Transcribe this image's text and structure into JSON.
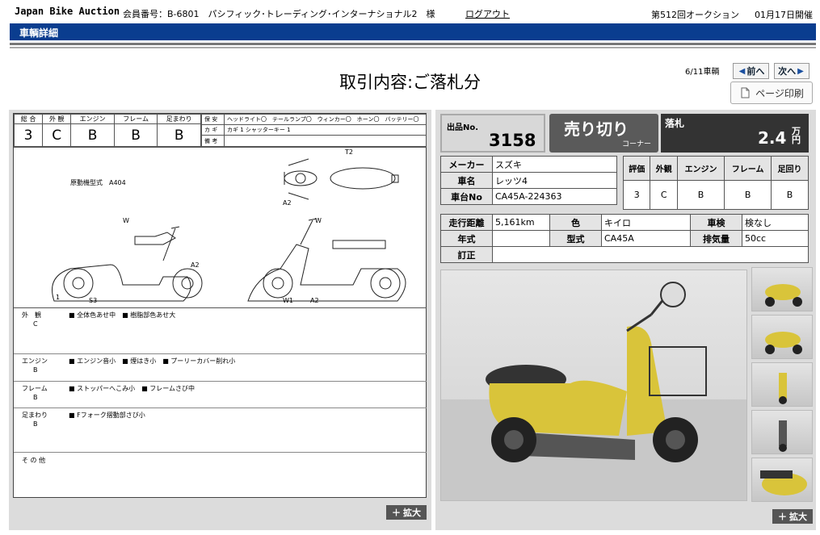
{
  "header": {
    "logo": "Japan Bike Auction",
    "member": "会員番号：B-6801　パシフィック･トレーディング･インターナショナル2　様",
    "logout": "ログアウト",
    "auction": "第512回オークション",
    "date": "01月17日開催"
  },
  "bar": {
    "title": "車輌詳細"
  },
  "main": {
    "title": "取引内容:ご落札分",
    "counter": "6/11車輌",
    "prev": "前へ",
    "next": "次へ",
    "print": "ページ印刷",
    "expand": "拡大"
  },
  "sheet": {
    "grades_labels": [
      "総 合",
      "外 観",
      "エンジン",
      "フレーム",
      "足まわり"
    ],
    "grades": [
      "3",
      "C",
      "B",
      "B",
      "B"
    ],
    "r1_label": "保 安",
    "r1_items": "ヘッドライト〇　テールランプ〇　ウィンカー〇　ホーン〇　バッテリー〇",
    "r2_label": "カ ギ",
    "r2_value": "カギ 1  シャッターキー 1",
    "r3_label": "備 考",
    "model_text": "原動機型式　A404",
    "marks": {
      "t2": "T2",
      "a2": "A2",
      "w": "W",
      "s3": "S3",
      "one": "1",
      "w1": "W1"
    },
    "sections": [
      {
        "label": "外　観",
        "grade": "C",
        "text": "■ 全体色あせ中　■ 樹脂部色あせ大"
      },
      {
        "label": "エンジン",
        "grade": "B",
        "text": "■ エンジン音小　■ 煙はき小　■ プーリーカバー削れ小"
      },
      {
        "label": "フレーム",
        "grade": "B",
        "text": "■ ストッパーへこみ小　■ フレームさび中"
      },
      {
        "label": "足まわり",
        "grade": "B",
        "text": "■ Fフォーク摺動部さび小"
      },
      {
        "label": "そ の 他",
        "grade": "",
        "text": ""
      }
    ]
  },
  "lot": {
    "label": "出品No.",
    "number": "3158",
    "corner_big": "売り切り",
    "corner_small": "コーナー",
    "sold_label": "落札",
    "price": "2.4",
    "unit1": "万",
    "unit2": "円"
  },
  "info": {
    "maker_l": "メーカー",
    "maker": "スズキ",
    "name_l": "車名",
    "name": "レッツ4",
    "frame_l": "車台No",
    "frame": "CA45A-224363",
    "eval_headers": [
      "評価",
      "外観",
      "エンジン",
      "フレーム",
      "足回り"
    ],
    "eval_values": [
      "3",
      "C",
      "B",
      "B",
      "B"
    ],
    "mileage_l": "走行距離",
    "mileage": "5,161km",
    "color_l": "色",
    "color": "キイロ",
    "inspect_l": "車検",
    "inspect": "検なし",
    "year_l": "年式",
    "year": "",
    "type_l": "型式",
    "type": "CA45A",
    "cc_l": "排気量",
    "cc": "50cc",
    "memo_l": "訂正",
    "memo": ""
  }
}
